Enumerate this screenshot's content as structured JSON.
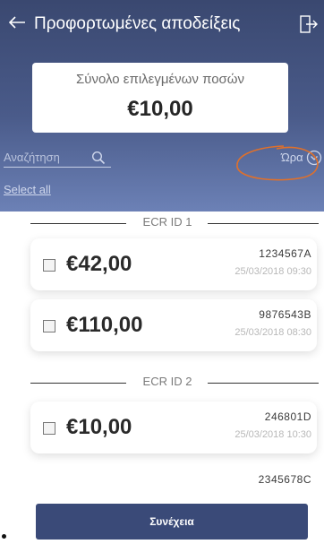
{
  "header": {
    "title": "Προφορτωμένες αποδείξεις",
    "total_label": "Σύνολο επιλεγμένων ποσών",
    "total_value": "€10,00"
  },
  "search": {
    "placeholder": "Αναζήτηση"
  },
  "sort": {
    "label": "Ώρα"
  },
  "select_all": "Select all",
  "groups": [
    {
      "label": "ECR ID 1",
      "receipts": [
        {
          "amount": "€42,00",
          "code": "1234567A",
          "date": "25/03/2018 09:30"
        },
        {
          "amount": "€110,00",
          "code": "9876543B",
          "date": "25/03/2018 08:30"
        }
      ]
    },
    {
      "label": "ECR ID 2",
      "receipts": [
        {
          "amount": "€10,00",
          "code": "246801D",
          "date": "25/03/2018 10:30"
        },
        {
          "amount": "",
          "code": "2345678C",
          "date": ""
        }
      ]
    }
  ],
  "footer": {
    "continue_label": "Συνέχεια"
  },
  "colors": {
    "header": "#4a5b8a",
    "button": "#3a4a78",
    "annotation": "#e0702a"
  }
}
